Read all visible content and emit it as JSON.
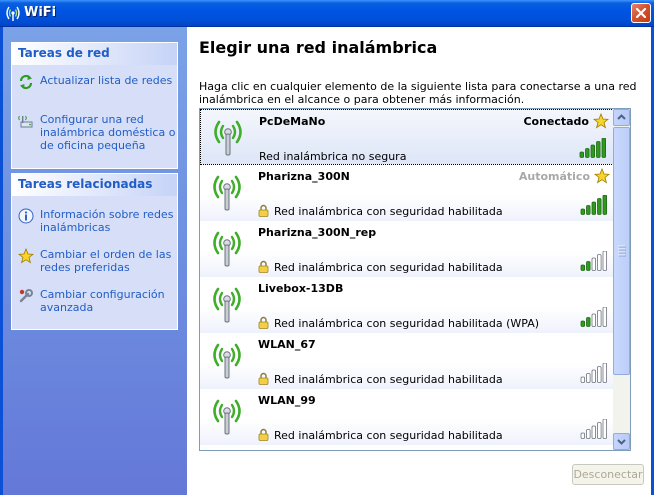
{
  "window": {
    "title": "WiFi"
  },
  "sidebar": {
    "groups": [
      {
        "title": "Tareas de red",
        "tasks": [
          {
            "label": "Actualizar lista de redes",
            "icon": "refresh-icon"
          },
          {
            "label": "Configurar una red inalámbrica doméstica o de oficina pequeña",
            "icon": "wireless-setup-icon"
          }
        ]
      },
      {
        "title": "Tareas relacionadas",
        "tasks": [
          {
            "label": "Información sobre redes inalámbricas",
            "icon": "info-icon"
          },
          {
            "label": "Cambiar el orden de las redes preferidas",
            "icon": "star-icon"
          },
          {
            "label": "Cambiar configuración avanzada",
            "icon": "settings-icon"
          }
        ]
      }
    ]
  },
  "main": {
    "heading": "Elegir una red inalámbrica",
    "description": "Haga clic en cualquier elemento de la siguiente lista para conectarse a una red inalámbrica en el alcance o para obtener más información.",
    "networks": [
      {
        "ssid": "PcDeMaNo",
        "status": "Conectado",
        "preferred": true,
        "security": "Red inalámbrica no segura",
        "secured": false,
        "signal_bars": 5,
        "selected": true
      },
      {
        "ssid": "Pharizna_300N",
        "status": "Automático",
        "preferred": true,
        "security": "Red inalámbrica con seguridad habilitada",
        "secured": true,
        "signal_bars": 5,
        "selected": false
      },
      {
        "ssid": "Pharizna_300N_rep",
        "status": "",
        "preferred": false,
        "security": "Red inalámbrica con seguridad habilitada",
        "secured": true,
        "signal_bars": 2,
        "selected": false
      },
      {
        "ssid": "Livebox-13DB",
        "status": "",
        "preferred": false,
        "security": "Red inalámbrica con seguridad habilitada (WPA)",
        "secured": true,
        "signal_bars": 2,
        "selected": false
      },
      {
        "ssid": "WLAN_67",
        "status": "",
        "preferred": false,
        "security": "Red inalámbrica con seguridad habilitada",
        "secured": true,
        "signal_bars": 0,
        "selected": false
      },
      {
        "ssid": "WLAN_99",
        "status": "",
        "preferred": false,
        "security": "Red inalámbrica con seguridad habilitada",
        "secured": true,
        "signal_bars": 0,
        "selected": false
      }
    ],
    "disconnect_label": "Desconectar"
  },
  "colors": {
    "signal_on": "#2f9a1f",
    "signal_off": "#ffffff",
    "link": "#215dc6",
    "titlebar": "#0054e3"
  }
}
